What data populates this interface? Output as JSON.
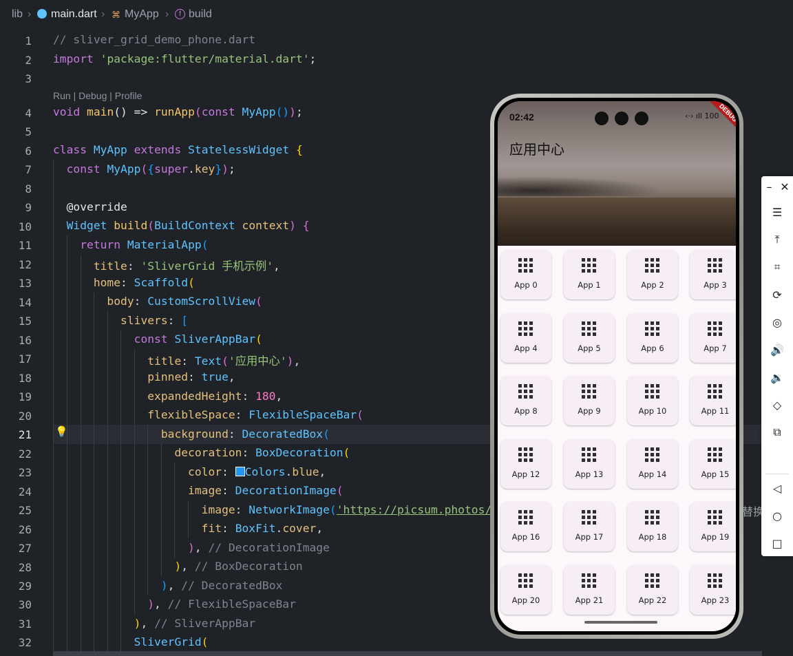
{
  "breadcrumb": [
    "lib",
    "main.dart",
    "MyApp",
    "build"
  ],
  "codelens": "Run | Debug | Profile",
  "active_line": 21,
  "line_numbers": [
    1,
    2,
    3,
    4,
    5,
    6,
    7,
    8,
    9,
    10,
    11,
    12,
    13,
    14,
    15,
    16,
    17,
    18,
    19,
    20,
    21,
    22,
    23,
    24,
    25,
    26,
    27,
    28,
    29,
    30,
    31,
    32
  ],
  "code": {
    "l1": "// sliver_grid_demo_phone.dart",
    "l2_import": "import",
    "l2_pkg": "'package:flutter/material.dart'",
    "l4_void": "void",
    "l4_main": "main",
    "l4_arrow": "() =>",
    "l4_runapp": "runApp",
    "l4_const": "const",
    "l4_myapp": "MyApp",
    "l6_class": "class",
    "l6_name": "MyApp",
    "l6_extends": "extends",
    "l6_base": "StatelessWidget",
    "l7_const": "const",
    "l7_name": "MyApp",
    "l7_super": "super",
    "l7_key": "key",
    "l9": "@override",
    "l10_type": "Widget",
    "l10_fn": "build",
    "l10_ptype": "BuildContext",
    "l10_pname": "context",
    "l11_return": "return",
    "l11_widget": "MaterialApp",
    "l12_key": "title",
    "l12_val": "'SliverGrid 手机示例'",
    "l13_key": "home",
    "l13_val": "Scaffold",
    "l14_key": "body",
    "l14_val": "CustomScrollView",
    "l15_key": "slivers",
    "l16_const": "const",
    "l16_val": "SliverAppBar",
    "l17_key": "title",
    "l17_val": "Text",
    "l17_str": "'应用中心'",
    "l18_key": "pinned",
    "l18_val": "true",
    "l19_key": "expandedHeight",
    "l19_val": "180",
    "l20_key": "flexibleSpace",
    "l20_val": "FlexibleSpaceBar",
    "l21_key": "background",
    "l21_val": "DecoratedBox",
    "l22_key": "decoration",
    "l22_val": "BoxDecoration",
    "l23_key": "color",
    "l23_val": "Colors",
    "l23_prop": "blue",
    "l24_key": "image",
    "l24_val": "DecorationImage",
    "l25_key": "image",
    "l25_val": "NetworkImage",
    "l25_url": "'https://picsum.photos/",
    "l26_key": "fit",
    "l26_val": "BoxFit",
    "l26_prop": "cover",
    "l27_c": "// DecorationImage",
    "l28_c": "// BoxDecoration",
    "l29_c": "// DecoratedBox",
    "l30_c": "// FlexibleSpaceBar",
    "l31_c": "// SliverAppBar",
    "l32_val": "SliverGrid"
  },
  "peek_text": "替换",
  "phone": {
    "time": "02:42",
    "status_icons": "‹·› ıll 100",
    "debug_banner": "DEBUG",
    "app_title": "应用中心",
    "grid": [
      "App 0",
      "App 1",
      "App 2",
      "App 3",
      "App 4",
      "App 5",
      "App 6",
      "App 7",
      "App 8",
      "App 9",
      "App 10",
      "App 11",
      "App 12",
      "App 13",
      "App 14",
      "App 15",
      "App 16",
      "App 17",
      "App 18",
      "App 19",
      "App 20",
      "App 21",
      "App 22",
      "App 23"
    ]
  },
  "colors": {
    "editor_bg": "#1f2227",
    "accent_blue": "#2196f3",
    "debug_red": "#b71c1c"
  },
  "toolbar_icons": [
    "minimize-icon",
    "close-icon",
    "menu-icon",
    "pin-top-icon",
    "crop-icon",
    "rotate-icon",
    "record-icon",
    "volume-up-icon",
    "volume-down-icon",
    "screen-rotate-icon",
    "copy-icon",
    "back-icon",
    "home-icon",
    "recents-icon"
  ]
}
